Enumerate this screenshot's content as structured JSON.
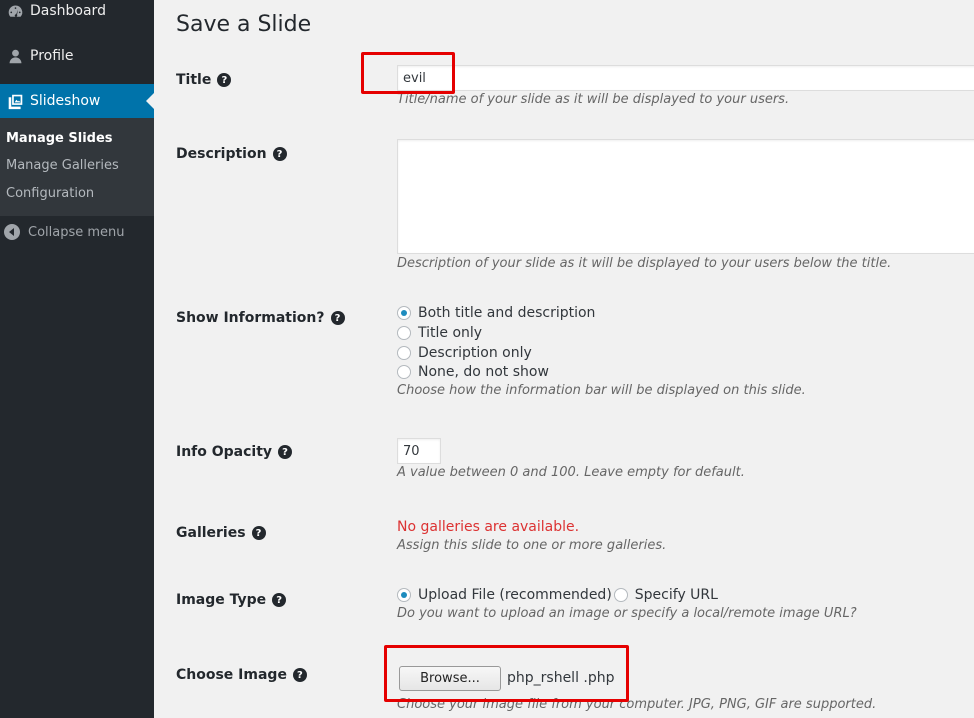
{
  "sidebar": {
    "items": [
      {
        "label": "Dashboard",
        "icon": "dashboard-icon"
      },
      {
        "label": "Profile",
        "icon": "user-icon"
      },
      {
        "label": "Slideshow",
        "icon": "slideshow-icon",
        "active": true
      }
    ],
    "submenu": [
      "Manage Slides",
      "Manage Galleries",
      "Configuration"
    ],
    "collapse_label": "Collapse menu",
    "active_color": "#0073aa",
    "background_color": "#23282d"
  },
  "page": {
    "title": "Save a Slide"
  },
  "form": {
    "title": {
      "label": "Title",
      "value": "evil",
      "description": "Title/name of your slide as it will be displayed to your users."
    },
    "description": {
      "label": "Description",
      "value": "",
      "description": "Description of your slide as it will be displayed to your users below the title."
    },
    "show_information": {
      "label": "Show Information?",
      "options": [
        "Both title and description",
        "Title only",
        "Description only",
        "None, do not show"
      ],
      "selected": "Both title and description",
      "description": "Choose how the information bar will be displayed on this slide."
    },
    "info_opacity": {
      "label": "Info Opacity",
      "value": "70",
      "description": "A value between 0 and 100. Leave empty for default."
    },
    "galleries": {
      "label": "Galleries",
      "error": "No galleries are available.",
      "description": "Assign this slide to one or more galleries."
    },
    "image_type": {
      "label": "Image Type",
      "options": [
        "Upload File (recommended)",
        "Specify URL"
      ],
      "selected": "Upload File (recommended)",
      "description": "Do you want to upload an image or specify a local/remote image URL?"
    },
    "choose_image": {
      "label": "Choose Image",
      "button": "Browse...",
      "file_name": "php_rshell .php",
      "description": "Choose your image file from your computer. JPG, PNG, GIF are supported."
    }
  },
  "help_glyph": "?",
  "annotation_color": "#e50000"
}
